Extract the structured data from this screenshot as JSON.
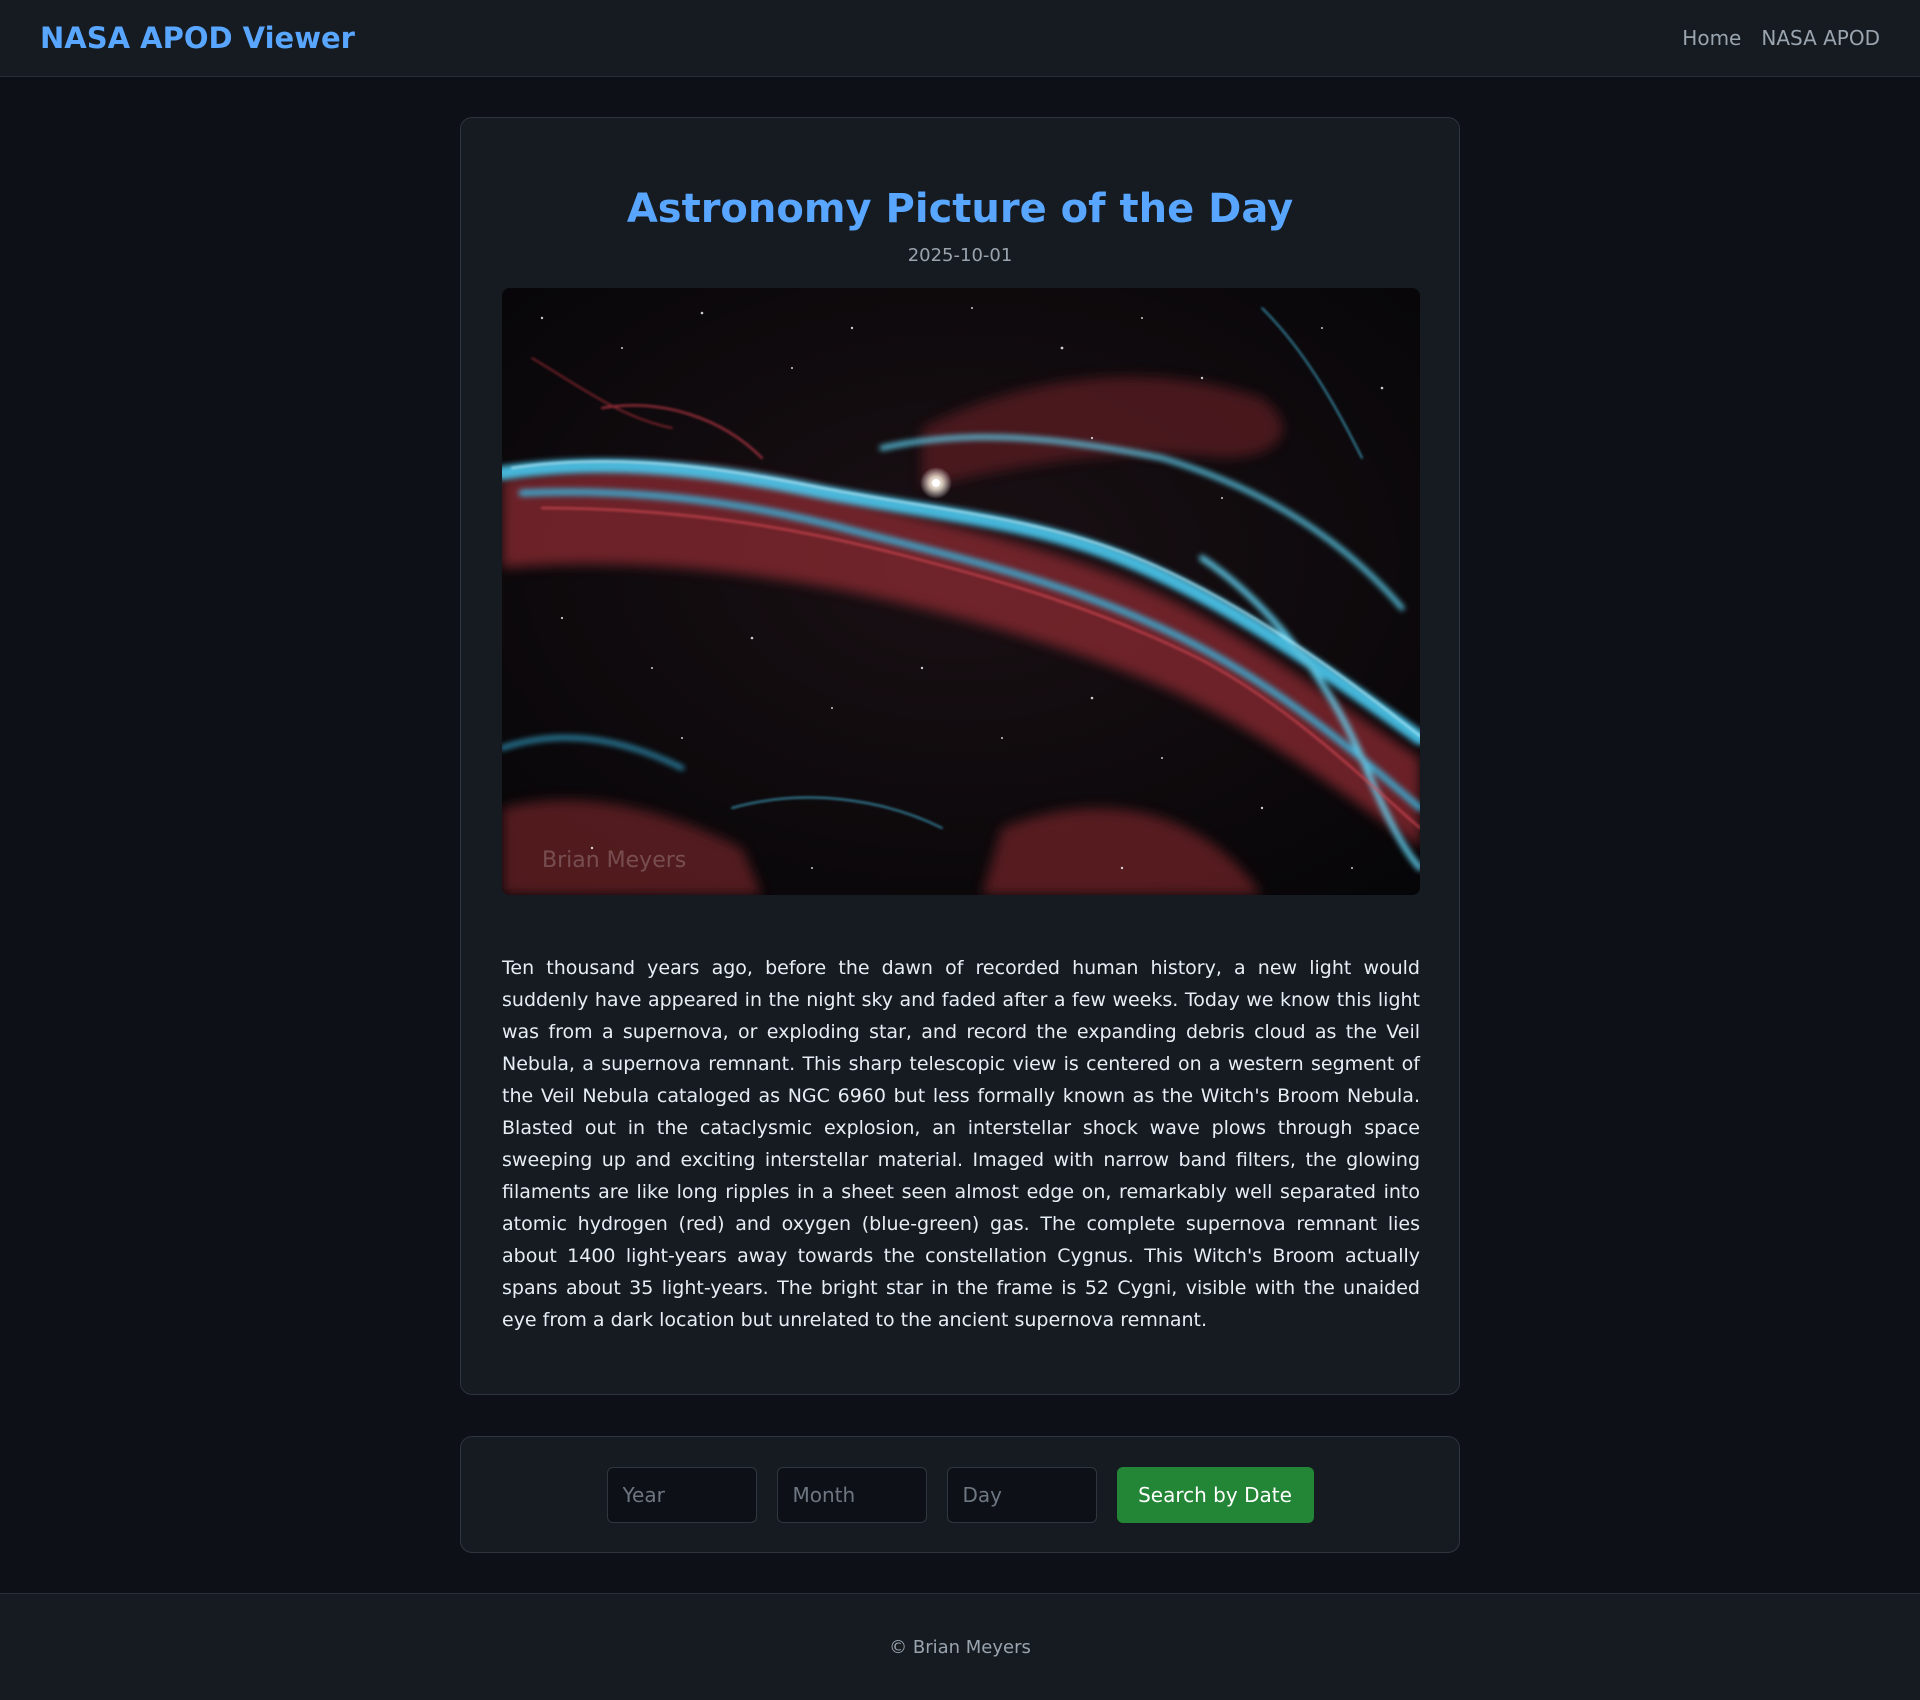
{
  "header": {
    "brand": "NASA APOD Viewer",
    "nav": [
      {
        "label": "Home"
      },
      {
        "label": "NASA APOD"
      }
    ]
  },
  "apod": {
    "title": "Astronomy Picture of the Day",
    "date": "2025-10-01",
    "image_watermark": "Brian Meyers",
    "explanation": "Ten thousand years ago, before the dawn of recorded human history, a new light would suddenly have appeared in the night sky and faded after a few weeks. Today we know this light was from a supernova, or exploding star, and record the expanding debris cloud as the Veil Nebula, a supernova remnant. This sharp telescopic view is centered on a western segment of the Veil Nebula cataloged as NGC 6960 but less formally known as the Witch's Broom Nebula. Blasted out in the cataclysmic explosion, an interstellar shock wave plows through space sweeping up and exciting interstellar material. Imaged with narrow band filters, the glowing filaments are like long ripples in a sheet seen almost edge on, remarkably well separated into atomic hydrogen (red) and oxygen (blue-green) gas. The complete supernova remnant lies about 1400 light-years away towards the constellation Cygnus. This Witch's Broom actually spans about 35 light-years. The bright star in the frame is 52 Cygni, visible with the unaided eye from a dark location but unrelated to the ancient supernova remnant."
  },
  "search": {
    "year_placeholder": "Year",
    "month_placeholder": "Month",
    "day_placeholder": "Day",
    "button_label": "Search by Date"
  },
  "footer": {
    "copyright": "© Brian Meyers"
  },
  "colors": {
    "accent": "#58a6ff",
    "button": "#238636",
    "background": "#0d1117",
    "card": "#161b22"
  }
}
